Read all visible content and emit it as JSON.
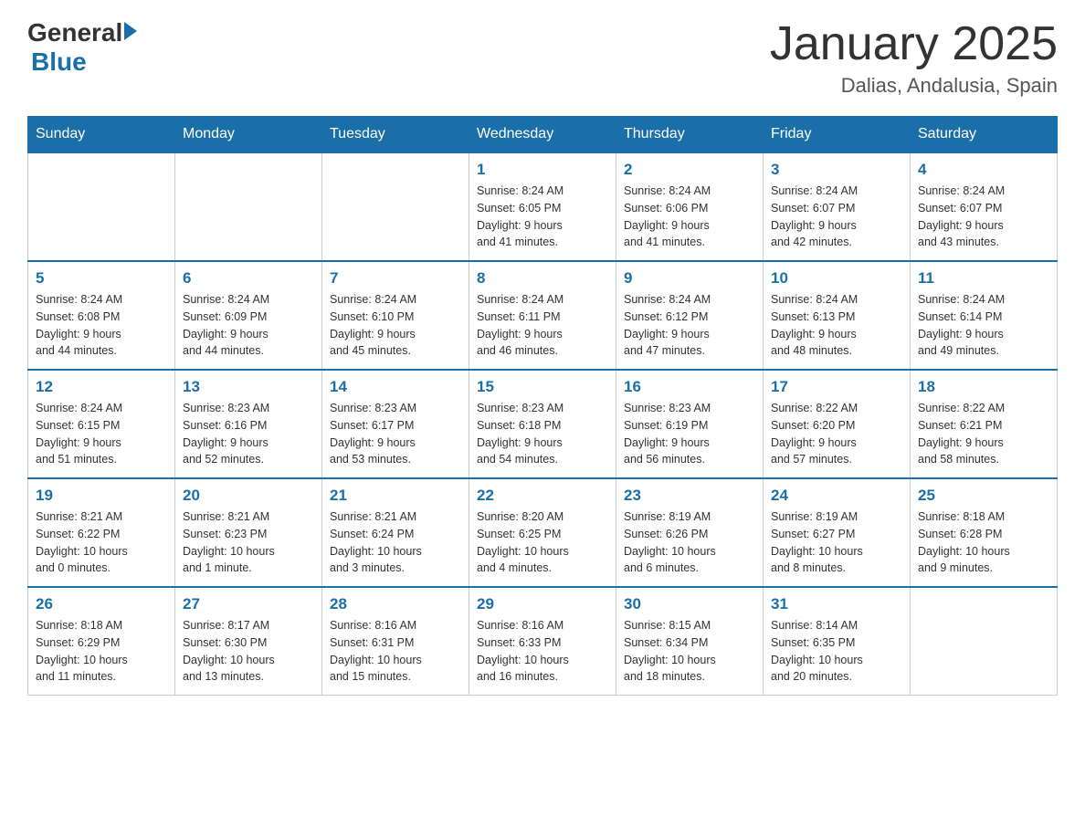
{
  "header": {
    "logo": {
      "general": "General",
      "arrow": "▶",
      "blue": "Blue"
    },
    "title": "January 2025",
    "subtitle": "Dalias, Andalusia, Spain"
  },
  "weekdays": [
    "Sunday",
    "Monday",
    "Tuesday",
    "Wednesday",
    "Thursday",
    "Friday",
    "Saturday"
  ],
  "weeks": [
    [
      {
        "day": "",
        "info": ""
      },
      {
        "day": "",
        "info": ""
      },
      {
        "day": "",
        "info": ""
      },
      {
        "day": "1",
        "info": "Sunrise: 8:24 AM\nSunset: 6:05 PM\nDaylight: 9 hours\nand 41 minutes."
      },
      {
        "day": "2",
        "info": "Sunrise: 8:24 AM\nSunset: 6:06 PM\nDaylight: 9 hours\nand 41 minutes."
      },
      {
        "day": "3",
        "info": "Sunrise: 8:24 AM\nSunset: 6:07 PM\nDaylight: 9 hours\nand 42 minutes."
      },
      {
        "day": "4",
        "info": "Sunrise: 8:24 AM\nSunset: 6:07 PM\nDaylight: 9 hours\nand 43 minutes."
      }
    ],
    [
      {
        "day": "5",
        "info": "Sunrise: 8:24 AM\nSunset: 6:08 PM\nDaylight: 9 hours\nand 44 minutes."
      },
      {
        "day": "6",
        "info": "Sunrise: 8:24 AM\nSunset: 6:09 PM\nDaylight: 9 hours\nand 44 minutes."
      },
      {
        "day": "7",
        "info": "Sunrise: 8:24 AM\nSunset: 6:10 PM\nDaylight: 9 hours\nand 45 minutes."
      },
      {
        "day": "8",
        "info": "Sunrise: 8:24 AM\nSunset: 6:11 PM\nDaylight: 9 hours\nand 46 minutes."
      },
      {
        "day": "9",
        "info": "Sunrise: 8:24 AM\nSunset: 6:12 PM\nDaylight: 9 hours\nand 47 minutes."
      },
      {
        "day": "10",
        "info": "Sunrise: 8:24 AM\nSunset: 6:13 PM\nDaylight: 9 hours\nand 48 minutes."
      },
      {
        "day": "11",
        "info": "Sunrise: 8:24 AM\nSunset: 6:14 PM\nDaylight: 9 hours\nand 49 minutes."
      }
    ],
    [
      {
        "day": "12",
        "info": "Sunrise: 8:24 AM\nSunset: 6:15 PM\nDaylight: 9 hours\nand 51 minutes."
      },
      {
        "day": "13",
        "info": "Sunrise: 8:23 AM\nSunset: 6:16 PM\nDaylight: 9 hours\nand 52 minutes."
      },
      {
        "day": "14",
        "info": "Sunrise: 8:23 AM\nSunset: 6:17 PM\nDaylight: 9 hours\nand 53 minutes."
      },
      {
        "day": "15",
        "info": "Sunrise: 8:23 AM\nSunset: 6:18 PM\nDaylight: 9 hours\nand 54 minutes."
      },
      {
        "day": "16",
        "info": "Sunrise: 8:23 AM\nSunset: 6:19 PM\nDaylight: 9 hours\nand 56 minutes."
      },
      {
        "day": "17",
        "info": "Sunrise: 8:22 AM\nSunset: 6:20 PM\nDaylight: 9 hours\nand 57 minutes."
      },
      {
        "day": "18",
        "info": "Sunrise: 8:22 AM\nSunset: 6:21 PM\nDaylight: 9 hours\nand 58 minutes."
      }
    ],
    [
      {
        "day": "19",
        "info": "Sunrise: 8:21 AM\nSunset: 6:22 PM\nDaylight: 10 hours\nand 0 minutes."
      },
      {
        "day": "20",
        "info": "Sunrise: 8:21 AM\nSunset: 6:23 PM\nDaylight: 10 hours\nand 1 minute."
      },
      {
        "day": "21",
        "info": "Sunrise: 8:21 AM\nSunset: 6:24 PM\nDaylight: 10 hours\nand 3 minutes."
      },
      {
        "day": "22",
        "info": "Sunrise: 8:20 AM\nSunset: 6:25 PM\nDaylight: 10 hours\nand 4 minutes."
      },
      {
        "day": "23",
        "info": "Sunrise: 8:19 AM\nSunset: 6:26 PM\nDaylight: 10 hours\nand 6 minutes."
      },
      {
        "day": "24",
        "info": "Sunrise: 8:19 AM\nSunset: 6:27 PM\nDaylight: 10 hours\nand 8 minutes."
      },
      {
        "day": "25",
        "info": "Sunrise: 8:18 AM\nSunset: 6:28 PM\nDaylight: 10 hours\nand 9 minutes."
      }
    ],
    [
      {
        "day": "26",
        "info": "Sunrise: 8:18 AM\nSunset: 6:29 PM\nDaylight: 10 hours\nand 11 minutes."
      },
      {
        "day": "27",
        "info": "Sunrise: 8:17 AM\nSunset: 6:30 PM\nDaylight: 10 hours\nand 13 minutes."
      },
      {
        "day": "28",
        "info": "Sunrise: 8:16 AM\nSunset: 6:31 PM\nDaylight: 10 hours\nand 15 minutes."
      },
      {
        "day": "29",
        "info": "Sunrise: 8:16 AM\nSunset: 6:33 PM\nDaylight: 10 hours\nand 16 minutes."
      },
      {
        "day": "30",
        "info": "Sunrise: 8:15 AM\nSunset: 6:34 PM\nDaylight: 10 hours\nand 18 minutes."
      },
      {
        "day": "31",
        "info": "Sunrise: 8:14 AM\nSunset: 6:35 PM\nDaylight: 10 hours\nand 20 minutes."
      },
      {
        "day": "",
        "info": ""
      }
    ]
  ]
}
